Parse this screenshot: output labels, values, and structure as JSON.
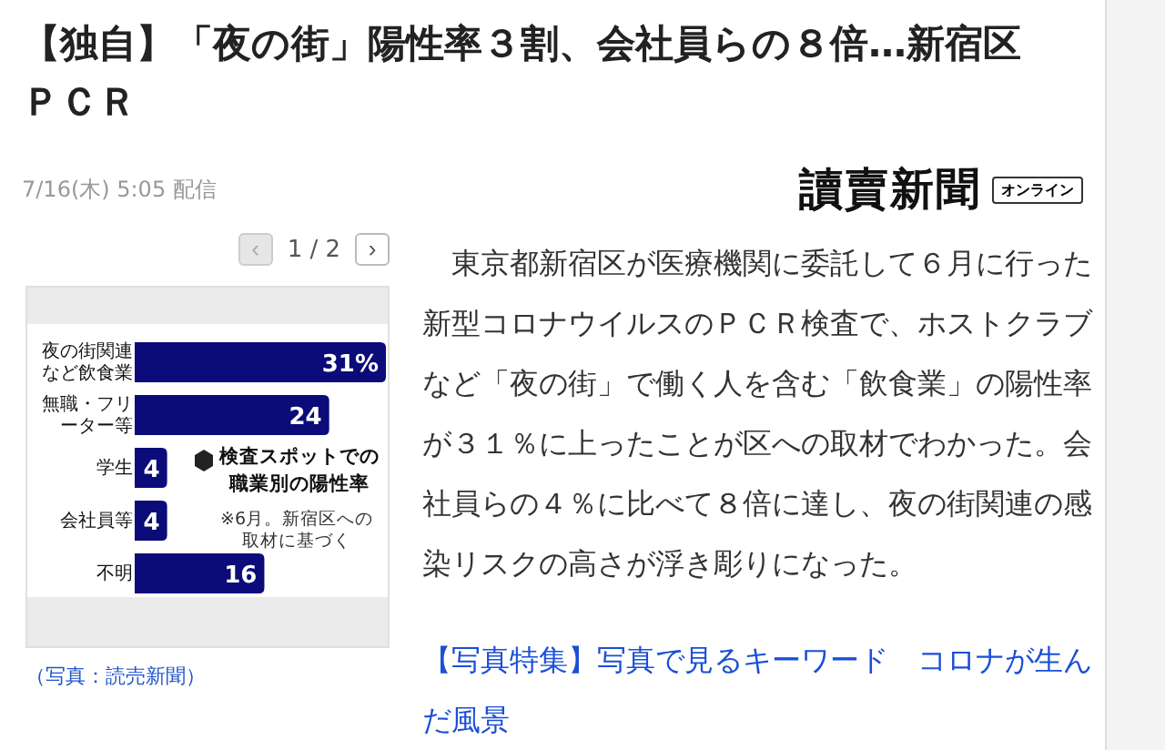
{
  "article": {
    "title": "【独自】「夜の街」陽性率３割、会社員らの８倍…新宿区ＰＣＲ",
    "date": "7/16(木) 5:05 配信",
    "publisher": {
      "logo": "讀賣新聞",
      "badge": "オンライン"
    }
  },
  "gallery": {
    "prev": {
      "label": "‹",
      "disabled": true
    },
    "counter": "1 / 2",
    "next": {
      "label": "›",
      "disabled": false
    },
    "chart_data": {
      "type": "bar",
      "orientation": "horizontal",
      "title": "検査スポットでの職業別の陽性率",
      "categories": [
        "夜の街関連など飲食業",
        "無職・フリーター等",
        "学生",
        "会社員等",
        "不明"
      ],
      "values": [
        31,
        24,
        4,
        4,
        16
      ],
      "data_labels": true,
      "value_labels": [
        "31%",
        "24",
        "4",
        "4",
        "16"
      ],
      "annotations": [
        "※6月。新宿区への取材に基づく"
      ]
    },
    "caption": "（写真：読売新聞）"
  },
  "body": "　東京都新宿区が医療機関に委託して６月に行った新型コロナウイルスのＰＣＲ検査で、ホストクラブなど「夜の街」で働く人を含む「飲食業」の陽性率が３１％に上ったことが区への取材でわかった。会社員らの４％に比べて８倍に達し、夜の街関連の感染リスクの高さが浮き彫りになった。",
  "related_link": "【写真特集】写真で見るキーワード　コロナが生んだ風景"
}
